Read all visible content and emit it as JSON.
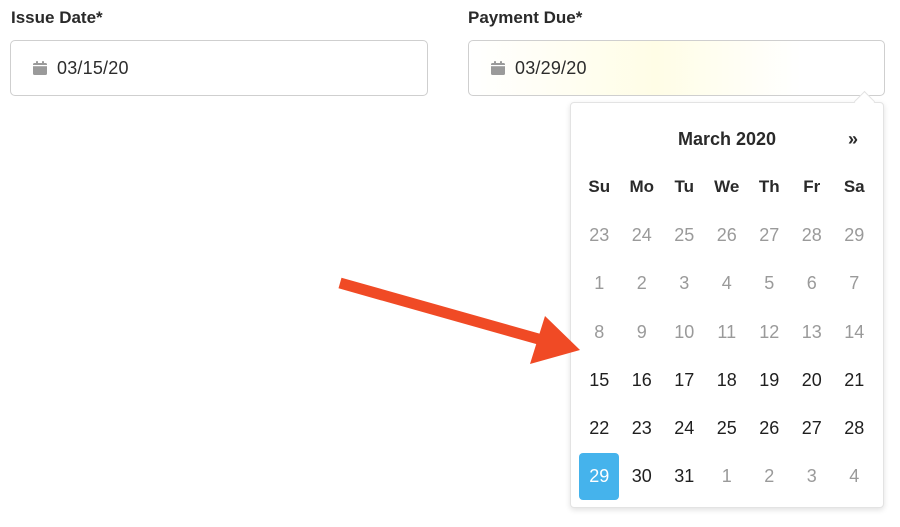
{
  "issue_date": {
    "label": "Issue Date*",
    "value": "03/15/20",
    "icon": "calendar-icon"
  },
  "payment_due": {
    "label": "Payment Due*",
    "value": "03/29/20",
    "icon": "calendar-icon"
  },
  "datepicker": {
    "month_title": "March 2020",
    "next_label": "»",
    "weekdays": [
      "Su",
      "Mo",
      "Tu",
      "We",
      "Th",
      "Fr",
      "Sa"
    ],
    "weeks": [
      [
        {
          "d": "23",
          "muted": true
        },
        {
          "d": "24",
          "muted": true
        },
        {
          "d": "25",
          "muted": true
        },
        {
          "d": "26",
          "muted": true
        },
        {
          "d": "27",
          "muted": true
        },
        {
          "d": "28",
          "muted": true
        },
        {
          "d": "29",
          "muted": true
        }
      ],
      [
        {
          "d": "1",
          "muted": true
        },
        {
          "d": "2",
          "muted": true
        },
        {
          "d": "3",
          "muted": true
        },
        {
          "d": "4",
          "muted": true
        },
        {
          "d": "5",
          "muted": true
        },
        {
          "d": "6",
          "muted": true
        },
        {
          "d": "7",
          "muted": true
        }
      ],
      [
        {
          "d": "8",
          "muted": true
        },
        {
          "d": "9",
          "muted": true
        },
        {
          "d": "10",
          "muted": true
        },
        {
          "d": "11",
          "muted": true
        },
        {
          "d": "12",
          "muted": true
        },
        {
          "d": "13",
          "muted": true
        },
        {
          "d": "14",
          "muted": true
        }
      ],
      [
        {
          "d": "15",
          "muted": false
        },
        {
          "d": "16",
          "muted": false
        },
        {
          "d": "17",
          "muted": false
        },
        {
          "d": "18",
          "muted": false
        },
        {
          "d": "19",
          "muted": false
        },
        {
          "d": "20",
          "muted": false
        },
        {
          "d": "21",
          "muted": false
        }
      ],
      [
        {
          "d": "22",
          "muted": false
        },
        {
          "d": "23",
          "muted": false
        },
        {
          "d": "24",
          "muted": false
        },
        {
          "d": "25",
          "muted": false
        },
        {
          "d": "26",
          "muted": false
        },
        {
          "d": "27",
          "muted": false
        },
        {
          "d": "28",
          "muted": false
        }
      ],
      [
        {
          "d": "29",
          "muted": false,
          "selected": true
        },
        {
          "d": "30",
          "muted": false
        },
        {
          "d": "31",
          "muted": false
        },
        {
          "d": "1",
          "muted": true
        },
        {
          "d": "2",
          "muted": true
        },
        {
          "d": "3",
          "muted": true
        },
        {
          "d": "4",
          "muted": true
        }
      ]
    ],
    "selected_color": "#45b3ec"
  },
  "annotation": {
    "arrow_color": "#f04a25",
    "arrow_icon": "red-arrow-icon"
  }
}
